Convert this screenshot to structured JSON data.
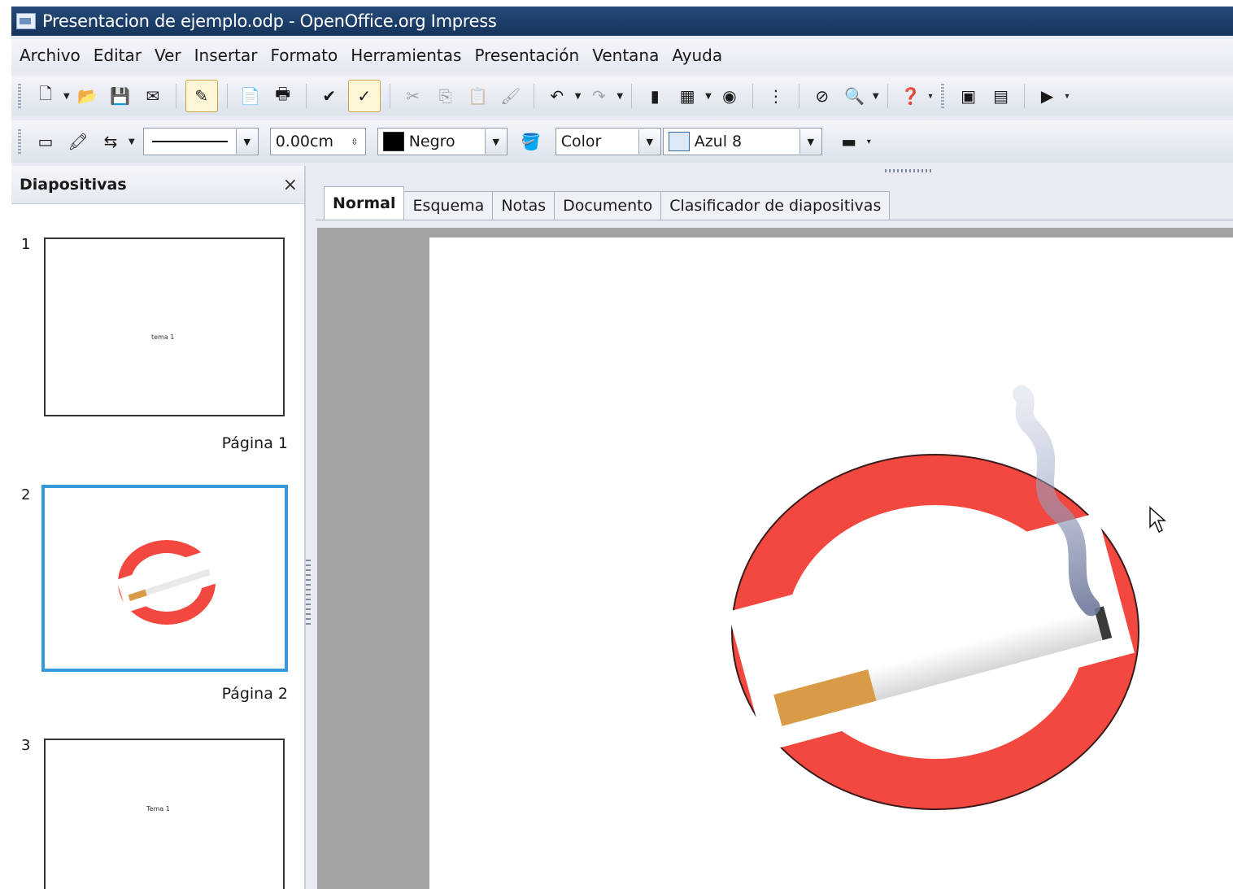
{
  "window": {
    "title": "Presentacion de ejemplo.odp - OpenOffice.org Impress"
  },
  "menu": [
    "Archivo",
    "Editar",
    "Ver",
    "Insertar",
    "Formato",
    "Herramientas",
    "Presentación",
    "Ventana",
    "Ayuda"
  ],
  "line_toolbar": {
    "line_width": "0.00cm",
    "line_color": "Negro",
    "area_style": "Color",
    "area_color": "Azul 8",
    "line_color_hex": "#000000",
    "area_color_hex": "#dbe9f7"
  },
  "slides_panel": {
    "title": "Diapositivas",
    "close_glyph": "×",
    "slides": [
      {
        "number": "1",
        "label": "Página 1",
        "thumb_text": "tema 1"
      },
      {
        "number": "2",
        "label": "Página 2",
        "thumb_text": ""
      },
      {
        "number": "3",
        "label": "",
        "thumb_text": "Tema 1"
      }
    ]
  },
  "view_tabs": [
    "Normal",
    "Esquema",
    "Notas",
    "Documento",
    "Clasificador de diapositivas"
  ],
  "active_tab": "Normal",
  "colors": {
    "titlebar": "#1d3f6b",
    "selection_border": "#3498db",
    "no_smoking_red": "#f2483f",
    "canvas_background": "#a3a3a3"
  },
  "icons": {
    "titlebar": "impress-app-icon",
    "close": "close-icon",
    "cursor": "mouse-pointer-icon"
  }
}
